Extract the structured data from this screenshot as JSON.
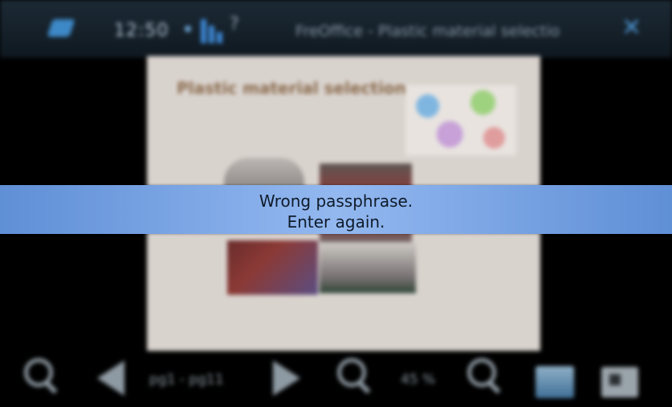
{
  "statusbar": {
    "clock": "12:50",
    "window_title": "FreOffice - Plastic material selectio",
    "close_label": "✕"
  },
  "slide": {
    "title": "Plastic material selection"
  },
  "toolbar": {
    "pages": "pg1 - pg11",
    "zoom": "45 %"
  },
  "notification": {
    "line1": "Wrong passphrase.",
    "line2": "Enter again."
  }
}
